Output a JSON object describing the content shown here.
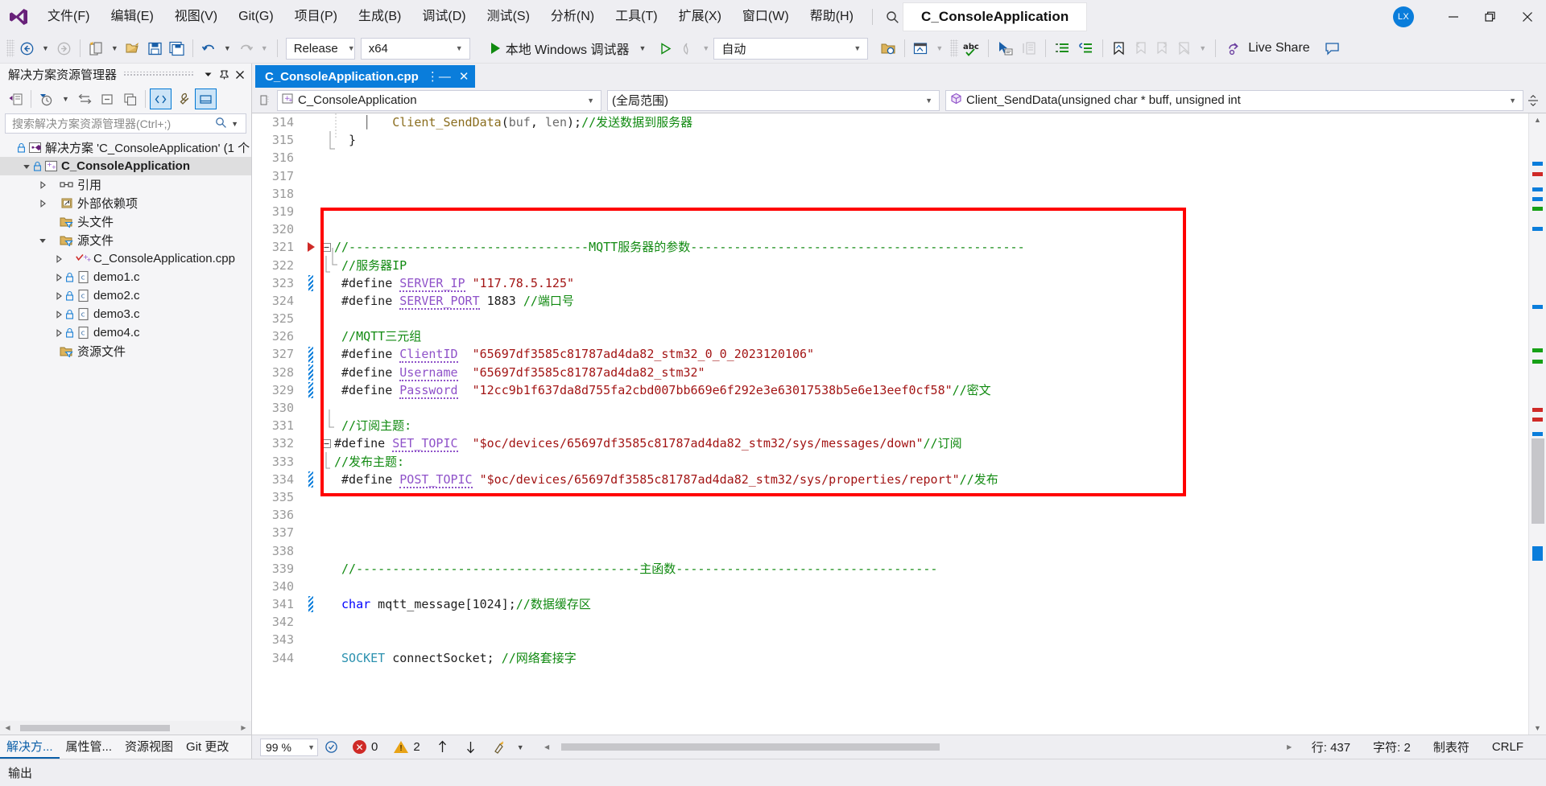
{
  "window": {
    "title": "C_ConsoleApplication",
    "avatar_initials": "LX",
    "minimize_icon": "minimize-icon",
    "restore_icon": "restore-icon",
    "close_icon": "close-icon"
  },
  "menubar": {
    "items": [
      {
        "label": "文件(F)",
        "name": "menu-file"
      },
      {
        "label": "编辑(E)",
        "name": "menu-edit"
      },
      {
        "label": "视图(V)",
        "name": "menu-view"
      },
      {
        "label": "Git(G)",
        "name": "menu-git"
      },
      {
        "label": "项目(P)",
        "name": "menu-project"
      },
      {
        "label": "生成(B)",
        "name": "menu-build"
      },
      {
        "label": "调试(D)",
        "name": "menu-debug"
      },
      {
        "label": "测试(S)",
        "name": "menu-test"
      },
      {
        "label": "分析(N)",
        "name": "menu-analyze"
      },
      {
        "label": "工具(T)",
        "name": "menu-tools"
      },
      {
        "label": "扩展(X)",
        "name": "menu-extensions"
      },
      {
        "label": "窗口(W)",
        "name": "menu-window"
      },
      {
        "label": "帮助(H)",
        "name": "menu-help"
      }
    ],
    "search_label": "搜索"
  },
  "toolbar": {
    "configuration": "Release",
    "platform": "x64",
    "run_label": "本地 Windows 调试器",
    "auto_label": "自动",
    "live_share": "Live Share"
  },
  "solution_explorer": {
    "panel_title": "解决方案资源管理器",
    "search_placeholder": "搜索解决方案资源管理器(Ctrl+;)",
    "tree": [
      {
        "label": "解决方案 'C_ConsoleApplication' (1 个",
        "depth": 0,
        "arrow": "none",
        "icon": "solution-icon",
        "lock": true,
        "bold": false,
        "selected": false
      },
      {
        "label": "C_ConsoleApplication",
        "depth": 1,
        "arrow": "open",
        "icon": "cpp-project-icon",
        "lock": true,
        "bold": true,
        "selected": true
      },
      {
        "label": "引用",
        "depth": 2,
        "arrow": "closed",
        "icon": "references-icon",
        "lock": false,
        "bold": false,
        "selected": false
      },
      {
        "label": "外部依赖项",
        "depth": 2,
        "arrow": "closed",
        "icon": "external-deps-icon",
        "lock": false,
        "bold": false,
        "selected": false
      },
      {
        "label": "头文件",
        "depth": 2,
        "arrow": "none",
        "icon": "filter-folder-icon",
        "lock": false,
        "bold": false,
        "selected": false
      },
      {
        "label": "源文件",
        "depth": 2,
        "arrow": "open",
        "icon": "filter-folder-icon",
        "lock": false,
        "bold": false,
        "selected": false
      },
      {
        "label": "C_ConsoleApplication.cpp",
        "depth": 3,
        "arrow": "closed",
        "icon": "cpp-file-icon",
        "lock": false,
        "bold": false,
        "selected": false
      },
      {
        "label": "demo1.c",
        "depth": 3,
        "arrow": "closed",
        "icon": "c-file-icon",
        "lock": true,
        "bold": false,
        "selected": false
      },
      {
        "label": "demo2.c",
        "depth": 3,
        "arrow": "closed",
        "icon": "c-file-icon",
        "lock": true,
        "bold": false,
        "selected": false
      },
      {
        "label": "demo3.c",
        "depth": 3,
        "arrow": "closed",
        "icon": "c-file-icon",
        "lock": true,
        "bold": false,
        "selected": false
      },
      {
        "label": "demo4.c",
        "depth": 3,
        "arrow": "closed",
        "icon": "c-file-icon",
        "lock": true,
        "bold": false,
        "selected": false
      },
      {
        "label": "资源文件",
        "depth": 2,
        "arrow": "none",
        "icon": "filter-folder-icon",
        "lock": false,
        "bold": false,
        "selected": false
      }
    ],
    "bottom_tabs": [
      {
        "label": "解决方...",
        "active": true,
        "name": "tab-solution-explorer"
      },
      {
        "label": "属性管...",
        "active": false,
        "name": "tab-property-manager"
      },
      {
        "label": "资源视图",
        "active": false,
        "name": "tab-resource-view"
      },
      {
        "label": "Git 更改",
        "active": false,
        "name": "tab-git-changes"
      }
    ]
  },
  "editor": {
    "tab_label": "C_ConsoleApplication.cpp",
    "nav_project": "C_ConsoleApplication",
    "nav_scope": "(全局范围)",
    "nav_member": "Client_SendData(unsigned char * buff, unsigned int",
    "lines": [
      {
        "n": 314,
        "glyph": "",
        "fold": "",
        "change": "",
        "tokens": [
          {
            "t": "    ",
            "c": "plain"
          },
          {
            "t": "│",
            "c": "guide"
          },
          {
            "t": "   Client_SendData",
            "c": "fn"
          },
          {
            "t": "(",
            "c": "plain"
          },
          {
            "t": "buf",
            "c": "var"
          },
          {
            "t": ", ",
            "c": "plain"
          },
          {
            "t": "len",
            "c": "var"
          },
          {
            "t": ");",
            "c": "plain"
          },
          {
            "t": "//发送数据到服务器",
            "c": "com"
          }
        ]
      },
      {
        "n": 315,
        "glyph": "",
        "fold": "",
        "change": "",
        "tokens": [
          {
            "t": "  }",
            "c": "plain"
          }
        ]
      },
      {
        "n": 316,
        "glyph": "",
        "fold": "",
        "change": "",
        "tokens": []
      },
      {
        "n": 317,
        "glyph": "",
        "fold": "",
        "change": "",
        "tokens": []
      },
      {
        "n": 318,
        "glyph": "",
        "fold": "",
        "change": "",
        "tokens": []
      },
      {
        "n": 319,
        "glyph": "",
        "fold": "",
        "change": "",
        "tokens": []
      },
      {
        "n": 320,
        "glyph": "",
        "fold": "",
        "change": "",
        "tokens": []
      },
      {
        "n": 321,
        "glyph": "bookmark",
        "fold": "minus",
        "change": "",
        "tokens": [
          {
            "t": "//---------------------------------MQTT服务器的参数----------------------------------------------",
            "c": "com"
          }
        ]
      },
      {
        "n": 322,
        "glyph": "",
        "fold": "bar",
        "change": "",
        "tokens": [
          {
            "t": " //服务器IP",
            "c": "com"
          }
        ]
      },
      {
        "n": 323,
        "glyph": "",
        "fold": "",
        "change": "blue",
        "tokens": [
          {
            "t": " #define ",
            "c": "pp"
          },
          {
            "t": "SERVER_IP",
            "c": "macro-sq"
          },
          {
            "t": " ",
            "c": "plain"
          },
          {
            "t": "\"117.78.5.125\"",
            "c": "str"
          }
        ]
      },
      {
        "n": 324,
        "glyph": "",
        "fold": "",
        "change": "",
        "tokens": [
          {
            "t": " #define ",
            "c": "pp"
          },
          {
            "t": "SERVER_PORT",
            "c": "macro-sq"
          },
          {
            "t": " 1883 ",
            "c": "plain"
          },
          {
            "t": "//端口号",
            "c": "com"
          }
        ]
      },
      {
        "n": 325,
        "glyph": "",
        "fold": "",
        "change": "",
        "tokens": []
      },
      {
        "n": 326,
        "glyph": "",
        "fold": "",
        "change": "",
        "tokens": [
          {
            "t": " //MQTT三元组",
            "c": "com"
          }
        ]
      },
      {
        "n": 327,
        "glyph": "",
        "fold": "",
        "change": "blue",
        "tokens": [
          {
            "t": " #define ",
            "c": "pp"
          },
          {
            "t": "ClientID",
            "c": "macro-sq"
          },
          {
            "t": "  ",
            "c": "plain"
          },
          {
            "t": "\"65697df3585c81787ad4da82_stm32_0_0_2023120106\"",
            "c": "str"
          }
        ]
      },
      {
        "n": 328,
        "glyph": "",
        "fold": "",
        "change": "blue",
        "tokens": [
          {
            "t": " #define ",
            "c": "pp"
          },
          {
            "t": "Username",
            "c": "macro-sq"
          },
          {
            "t": "  ",
            "c": "plain"
          },
          {
            "t": "\"65697df3585c81787ad4da82_stm32\"",
            "c": "str"
          }
        ]
      },
      {
        "n": 329,
        "glyph": "",
        "fold": "",
        "change": "blue",
        "tokens": [
          {
            "t": " #define ",
            "c": "pp"
          },
          {
            "t": "Password",
            "c": "macro-sq"
          },
          {
            "t": "  ",
            "c": "plain"
          },
          {
            "t": "\"12cc9b1f637da8d755fa2cbd007bb669e6f292e3e63017538b5e6e13eef0cf58\"",
            "c": "str"
          },
          {
            "t": "//密文",
            "c": "com"
          }
        ]
      },
      {
        "n": 330,
        "glyph": "",
        "fold": "",
        "change": "",
        "tokens": []
      },
      {
        "n": 331,
        "glyph": "",
        "fold": "",
        "change": "",
        "tokens": [
          {
            "t": " //订阅主题:",
            "c": "com"
          }
        ]
      },
      {
        "n": 332,
        "glyph": "",
        "fold": "minus",
        "change": "",
        "tokens": [
          {
            "t": "#define ",
            "c": "pp"
          },
          {
            "t": "SET_TOPIC",
            "c": "macro-sq"
          },
          {
            "t": "  ",
            "c": "plain"
          },
          {
            "t": "\"$oc/devices/65697df3585c81787ad4da82_stm32/sys/messages/down\"",
            "c": "str"
          },
          {
            "t": "//订阅",
            "c": "com"
          }
        ]
      },
      {
        "n": 333,
        "glyph": "",
        "fold": "bar",
        "change": "",
        "tokens": [
          {
            "t": "//发布主题:",
            "c": "com"
          }
        ]
      },
      {
        "n": 334,
        "glyph": "",
        "fold": "",
        "change": "blue",
        "tokens": [
          {
            "t": " #define ",
            "c": "pp"
          },
          {
            "t": "POST_TOPIC",
            "c": "macro-sq"
          },
          {
            "t": " ",
            "c": "plain"
          },
          {
            "t": "\"$oc/devices/65697df3585c81787ad4da82_stm32/sys/properties/report\"",
            "c": "str"
          },
          {
            "t": "//发布",
            "c": "com"
          }
        ]
      },
      {
        "n": 335,
        "glyph": "",
        "fold": "",
        "change": "",
        "tokens": []
      },
      {
        "n": 336,
        "glyph": "",
        "fold": "",
        "change": "",
        "tokens": []
      },
      {
        "n": 337,
        "glyph": "",
        "fold": "",
        "change": "",
        "tokens": []
      },
      {
        "n": 338,
        "glyph": "",
        "fold": "",
        "change": "",
        "tokens": []
      },
      {
        "n": 339,
        "glyph": "",
        "fold": "",
        "change": "",
        "tokens": [
          {
            "t": " //---------------------------------------主函数------------------------------------",
            "c": "com"
          }
        ]
      },
      {
        "n": 340,
        "glyph": "",
        "fold": "",
        "change": "",
        "tokens": []
      },
      {
        "n": 341,
        "glyph": "",
        "fold": "",
        "change": "blue",
        "tokens": [
          {
            "t": " ",
            "c": "plain"
          },
          {
            "t": "char",
            "c": "kw"
          },
          {
            "t": " mqtt_message[1024];",
            "c": "plain"
          },
          {
            "t": "//数据缓存区",
            "c": "com"
          }
        ]
      },
      {
        "n": 342,
        "glyph": "",
        "fold": "",
        "change": "",
        "tokens": []
      },
      {
        "n": 343,
        "glyph": "",
        "fold": "",
        "change": "",
        "tokens": []
      },
      {
        "n": 344,
        "glyph": "",
        "fold": "",
        "change": "",
        "tokens": [
          {
            "t": " ",
            "c": "plain"
          },
          {
            "t": "SOCKET",
            "c": "type"
          },
          {
            "t": " connectSocket; ",
            "c": "plain"
          },
          {
            "t": "//网络套接字",
            "c": "com"
          }
        ]
      }
    ]
  },
  "status": {
    "zoom": "99 %",
    "errors": "0",
    "warnings": "2",
    "line_label": "行: 437",
    "col_label": "字符: 2",
    "tabs_label": "制表符",
    "eol_label": "CRLF"
  },
  "output": {
    "label": "输出"
  },
  "colors": {
    "accent": "#0a7ddb",
    "comment_green": "#118a11",
    "string_red": "#a31515",
    "macro_purple": "#8f52c9",
    "highlight_box": "#ff0000",
    "error_red": "#cf2a27",
    "warning_orange": "#e8a317"
  }
}
